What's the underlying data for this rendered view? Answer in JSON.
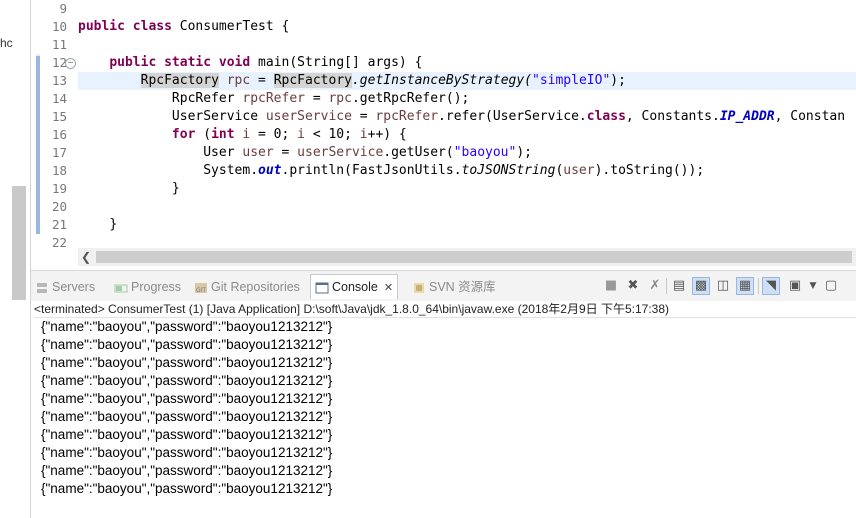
{
  "left_panel": {
    "fragment": "hc"
  },
  "editor": {
    "line_numbers": [
      "9",
      "10",
      "11",
      "12",
      "13",
      "14",
      "15",
      "16",
      "17",
      "18",
      "19",
      "20",
      "21",
      "22"
    ],
    "code": {
      "l10_kw1": "public",
      "l10_kw2": "class",
      "l10_name": "ConsumerTest {",
      "l12_kw1": "public",
      "l12_kw2": "static",
      "l12_kw3": "void",
      "l12_rest": "main(String[] args) {",
      "l13_type": "RpcFactory",
      "l13_var": "rpc",
      "l13_eq": " = ",
      "l13_type2": "RpcFactory",
      "l13_call": ".getInstanceByStrategy(",
      "l13_str": "\"simpleIO\"",
      "l13_end": ");",
      "l14_a": "RpcRefer ",
      "l14_var": "rpcRefer",
      "l14_b": " = ",
      "l14_var2": "rpc",
      "l14_c": ".getRpcRefer();",
      "l15_a": "UserService ",
      "l15_var": "userService",
      "l15_b": " = ",
      "l15_var2": "rpcRefer",
      "l15_c": ".refer(UserService.",
      "l15_kw": "class",
      "l15_d": ", Constants.",
      "l15_const": "IP_ADDR",
      "l15_e": ", Constan",
      "l16_kw": "for",
      "l16_a": " (",
      "l16_kw2": "int",
      "l16_var": " i",
      "l16_b": " = 0; ",
      "l16_var2": "i",
      "l16_c": " < 10; ",
      "l16_var3": "i",
      "l16_d": "++) {",
      "l17_a": "User ",
      "l17_var": "user",
      "l17_b": " = ",
      "l17_var2": "userService",
      "l17_c": ".getUser(",
      "l17_str": "\"baoyou\"",
      "l17_d": ");",
      "l18_a": "System.",
      "l18_out": "out",
      "l18_b": ".println(FastJsonUtils.",
      "l18_m": "toJSONString",
      "l18_c": "(",
      "l18_var": "user",
      "l18_d": ").toString());",
      "l19": "}",
      "l21": "}"
    }
  },
  "console_view": {
    "tabs": [
      {
        "label": "Servers",
        "icon": "servers-icon"
      },
      {
        "label": "Progress",
        "icon": "progress-icon"
      },
      {
        "label": "Git Repositories",
        "icon": "git-icon"
      },
      {
        "label": "Console",
        "icon": "console-icon",
        "close": "✕"
      },
      {
        "label": "SVN 资源库",
        "icon": "svn-icon"
      }
    ],
    "header": "<terminated> ConsumerTest (1) [Java Application] D:\\soft\\Java\\jdk_1.8.0_64\\bin\\javaw.exe (2018年2月9日 下午5:17:38)",
    "output": [
      "{\"name\":\"baoyou\",\"password\":\"baoyou1213212\"}",
      "{\"name\":\"baoyou\",\"password\":\"baoyou1213212\"}",
      "{\"name\":\"baoyou\",\"password\":\"baoyou1213212\"}",
      "{\"name\":\"baoyou\",\"password\":\"baoyou1213212\"}",
      "{\"name\":\"baoyou\",\"password\":\"baoyou1213212\"}",
      "{\"name\":\"baoyou\",\"password\":\"baoyou1213212\"}",
      "{\"name\":\"baoyou\",\"password\":\"baoyou1213212\"}",
      "{\"name\":\"baoyou\",\"password\":\"baoyou1213212\"}",
      "{\"name\":\"baoyou\",\"password\":\"baoyou1213212\"}",
      "{\"name\":\"baoyou\",\"password\":\"baoyou1213212\"}"
    ]
  },
  "colors": {
    "keyword": "#7f0055",
    "string": "#2a00ff",
    "field": "#0000c0",
    "local_var": "#6a3e3e",
    "current_line": "#e8f2fe"
  }
}
